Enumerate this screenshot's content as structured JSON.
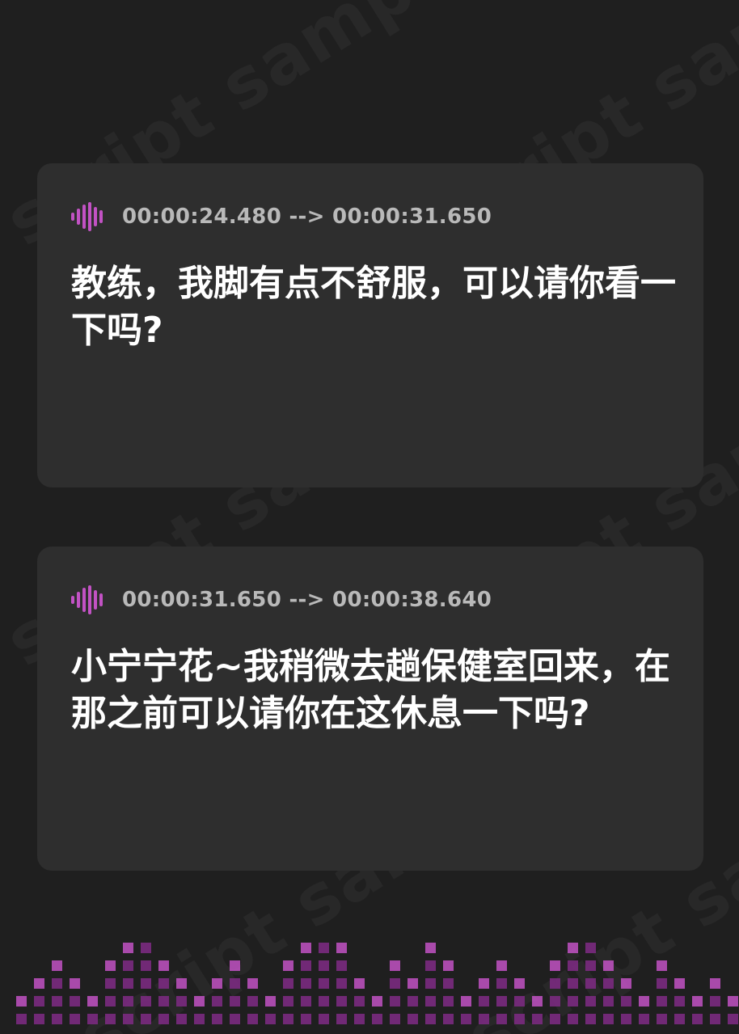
{
  "watermark_text": "script sample",
  "cards": [
    {
      "timestamp": "00:00:24.480 --> 00:00:31.650",
      "text": "教练，我脚有点不舒服，可以请你看一下吗?"
    },
    {
      "timestamp": "00:00:31.650 --> 00:00:38.640",
      "text": "小宁宁花~我稍微去趟保健室回来，在那之前可以请你在这休息一下吗?"
    }
  ],
  "icons": {
    "card_icon": "audio-waveform-icon"
  },
  "colors": {
    "background": "#1f1f1f",
    "card": "#2e2e2e",
    "accent": "#c252c4",
    "accent_dark": "#7a2a80",
    "timestamp": "#b9b9b9",
    "text": "#ffffff"
  }
}
